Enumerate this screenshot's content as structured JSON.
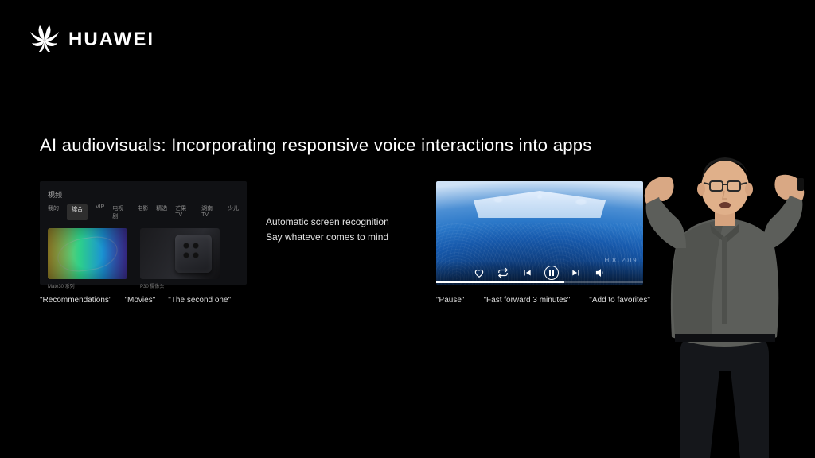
{
  "brand": {
    "name": "HUAWEI"
  },
  "slide": {
    "title": "AI audiovisuals: Incorporating responsive voice interactions into apps",
    "tv": {
      "header": "视频",
      "tabs": [
        "我的",
        "综合",
        "VIP",
        "电视剧",
        "电影",
        "精选",
        "芒果TV",
        "湖南TV",
        "少儿"
      ],
      "active_tab_index": 1,
      "tile1_caption": "Mate30 系列",
      "tile2_caption": "P30 摄像头",
      "voice_commands": [
        "\"Recommendations\"",
        "\"Movies\"",
        "\"The second one\""
      ]
    },
    "mid": {
      "line1": "Automatic screen recognition",
      "line2": "Say whatever comes to mind"
    },
    "video": {
      "watermark": "HDC 2019",
      "voice_commands": [
        "\"Pause\"",
        "\"Fast forward 3 minutes\"",
        "\"Add to favorites\""
      ]
    }
  }
}
